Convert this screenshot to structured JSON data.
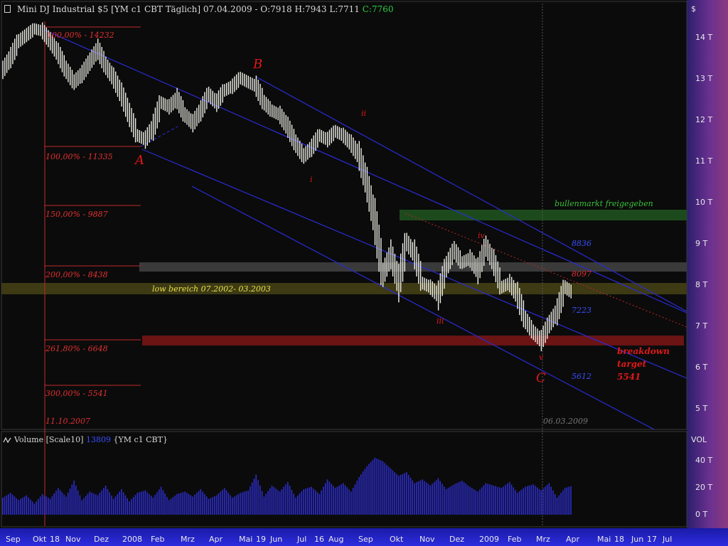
{
  "header": {
    "title": "Mini DJ Industrial $5 [YM c1 CBT  Täglich] 07.04.2009 - O:7918 H:7943 L:7711",
    "close": "C:7760"
  },
  "volume_header": {
    "label": "Volume [Scale10]",
    "value": "13809",
    "symbol": "{YM c1 CBT}"
  },
  "axis": {
    "currency": "$",
    "price_ticks": [
      "14 T",
      "13 T",
      "12 T",
      "11 T",
      "10 T",
      "9 T",
      "8 T",
      "7 T",
      "6 T",
      "5 T"
    ],
    "volume_title": "VOL",
    "volume_ticks": [
      "40 T",
      "20 T",
      "0 T"
    ],
    "x_ticks": [
      "Sep",
      "Okt",
      "18",
      "Nov",
      "Dez",
      "2008",
      "Feb",
      "Mrz",
      "Apr",
      "Mai",
      "19",
      "Jun",
      "Jul",
      "16",
      "Aug",
      "Sep",
      "Okt",
      "Nov",
      "Dez",
      "2009",
      "Feb",
      "Mrz",
      "Apr",
      "Mai",
      "18",
      "Jun",
      "17",
      "Jul"
    ]
  },
  "annotations": {
    "fib": [
      "100,00% - 14232",
      "100,00% - 11335",
      "150,00% - 9887",
      "200,00% - 8438",
      "261,80% - 6648",
      "300,00% - 5541"
    ],
    "date_left": "11.10.2007",
    "date_right": "06.03.2009",
    "wave_A": "A",
    "wave_B": "B",
    "wave_C": "C",
    "wave_i": "i",
    "wave_ii": "ii",
    "wave_iii": "iii",
    "wave_iv": "iv",
    "wave_v": "v",
    "bull": "bullenmarkt freigegeben",
    "low_zone": "low bereich 07.2002- 03.2003",
    "lvl_8836": "8836",
    "lvl_8097": "8097",
    "lvl_7223": "7223",
    "lvl_5612": "5612",
    "bd1": "breakdown",
    "bd2": "target",
    "bd3": "5541"
  },
  "colors": {
    "background": "#0b0b0b",
    "fib_text": "#e03030",
    "channel": "#2b2bd8",
    "bull_zone": "#1d4a1d",
    "low_zone": "#3d3a14",
    "breakdown_zone": "#6a1414",
    "bars": "#f0f0e8",
    "volume": "#2d2dd0",
    "wave_label": "#e01818"
  },
  "chart_data": {
    "type": "line",
    "series": [
      {
        "values": [
          13200,
          13500,
          13900,
          14050,
          14200,
          14150,
          13900,
          13600,
          13200,
          12900,
          13100,
          13400,
          13700,
          13300,
          13000,
          12600,
          12100,
          11600,
          11500,
          11800,
          12400,
          12300,
          12500,
          12100,
          11900,
          12200,
          12600,
          12400,
          12700,
          12800,
          13000,
          12900,
          12800,
          12400,
          12200,
          12100,
          11800,
          11400,
          11100,
          11300,
          11600,
          11500,
          11700,
          11600,
          11400,
          11100,
          10400,
          9500,
          8200,
          8700,
          8000,
          9000,
          8700,
          8000,
          7900,
          7700,
          8400,
          8800,
          8500,
          8600,
          8300,
          8900,
          8500,
          7900,
          8000,
          7700,
          7100,
          6800,
          6600,
          7000,
          7300,
          7900,
          7760
        ]
      }
    ],
    "ylim": [
      4500,
      14800
    ],
    "volume": {
      "ylim": [
        0,
        55000
      ],
      "values": [
        14000,
        18000,
        12000,
        16000,
        9000,
        17000,
        13000,
        22000,
        15000,
        28000,
        12000,
        19000,
        16000,
        24000,
        13000,
        21000,
        11000,
        18000,
        20000,
        14000,
        23000,
        12000,
        17000,
        19000,
        15000,
        21000,
        13000,
        16000,
        22000,
        14000,
        18000,
        20000,
        33000,
        15000,
        24000,
        19000,
        27000,
        14000,
        21000,
        23000,
        17000,
        29000,
        22000,
        26000,
        19000,
        31000,
        40000,
        47000,
        44000,
        38000,
        32000,
        35000,
        26000,
        29000,
        24000,
        30000,
        21000,
        25000,
        28000,
        23000,
        19000,
        26000,
        24000,
        22000,
        27000,
        18000,
        23000,
        25000,
        20000,
        26000,
        14000,
        22000,
        24000
      ]
    }
  }
}
